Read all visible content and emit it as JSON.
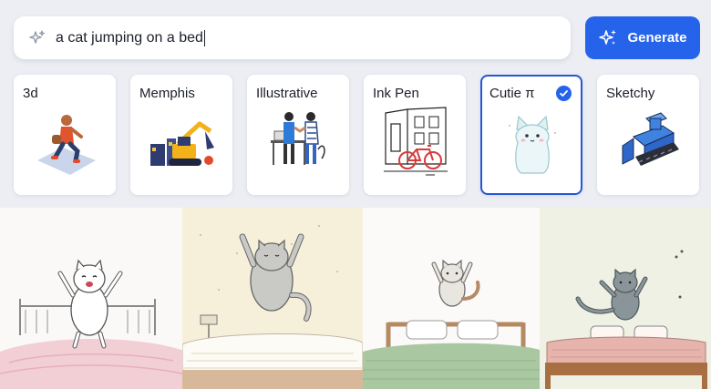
{
  "search": {
    "query": "a cat jumping on a bed",
    "icon": "sparkle-icon"
  },
  "generate_button": {
    "label": "Generate",
    "icon": "sparkles-icon",
    "color": "#2563eb"
  },
  "styles": [
    {
      "label": "3d",
      "icon": "runner-thumbnail",
      "selected": false
    },
    {
      "label": "Memphis",
      "icon": "excavator-thumbnail",
      "selected": false
    },
    {
      "label": "Illustrative",
      "icon": "handshake-thumbnail",
      "selected": false
    },
    {
      "label": "Ink Pen",
      "icon": "bicycle-street-thumbnail",
      "selected": false
    },
    {
      "label": "Cutie π",
      "icon": "cute-cat-thumbnail",
      "selected": true
    },
    {
      "label": "Sketchy",
      "icon": "bulldozer-thumbnail",
      "selected": false
    }
  ],
  "gallery": [
    {
      "name": "cat-on-pink-bed"
    },
    {
      "name": "cat-on-cream-bed"
    },
    {
      "name": "cat-on-green-bed"
    },
    {
      "name": "cat-on-wooden-bed"
    }
  ],
  "accent_color": "#2563eb"
}
